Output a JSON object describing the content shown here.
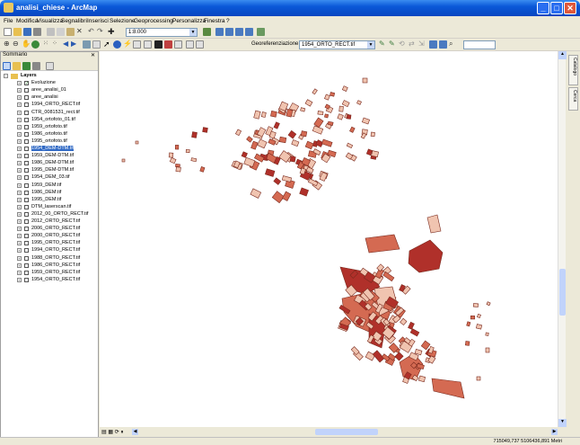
{
  "window": {
    "title": "analisi_chiese - ArcMap"
  },
  "menu": [
    "File",
    "Modifica",
    "Visualizza",
    "Segnalibri",
    "Inserisci",
    "Selezione",
    "Geoprocessing",
    "Personalizza",
    "Finestra",
    "?"
  ],
  "toolbar": {
    "scale": "1:8.000",
    "georef_label": "Georeferenziazione",
    "georef_layer": "1954_ORTO_RECT.tif"
  },
  "toc": {
    "title": "Sommario",
    "root": "Layers",
    "layers": [
      "Evoluzione",
      "aree_analisi_01",
      "aree_analisi",
      "1994_ORTO_RECT.tif",
      "CTR_0081531_rect.tif",
      "1954_ortofoto_01.tif",
      "1959_ortofoto.tif",
      "1986_ortofoto.tif",
      "1995_ortofoto.tif",
      "1954_DEM-DTM.tif",
      "1959_DEM-DTM.tif",
      "1986_DEM-DTM.tif",
      "1995_DEM-DTM.tif",
      "1954_DEM_03.tif",
      "1959_DEM.tif",
      "1986_DEM.tif",
      "1995_DEM.tif",
      "DTM_laserscan.tif",
      "2012_00_ORTO_RECT.tif",
      "2012_ORTO_RECT.tif",
      "2006_ORTO_RECT.tif",
      "2000_ORTO_RECT.tif",
      "1995_ORTO_RECT.tif",
      "1994_ORTO_RECT.tif",
      "1988_ORTO_RECT.tif",
      "1986_ORTO_RECT.tif",
      "1959_ORTO_RECT.tif",
      "1954_ORTO_RECT.tif"
    ],
    "checked_index": 0,
    "selected_index": 9
  },
  "dock_tabs": [
    "Catalogo",
    "Cerca"
  ],
  "status": {
    "coordinates": "715049,737  5106436,891 Metri"
  },
  "colors": {
    "dark": "#b0302a",
    "mid": "#d46a52",
    "light": "#f0c4b0",
    "outline": "#7a2a1e"
  }
}
